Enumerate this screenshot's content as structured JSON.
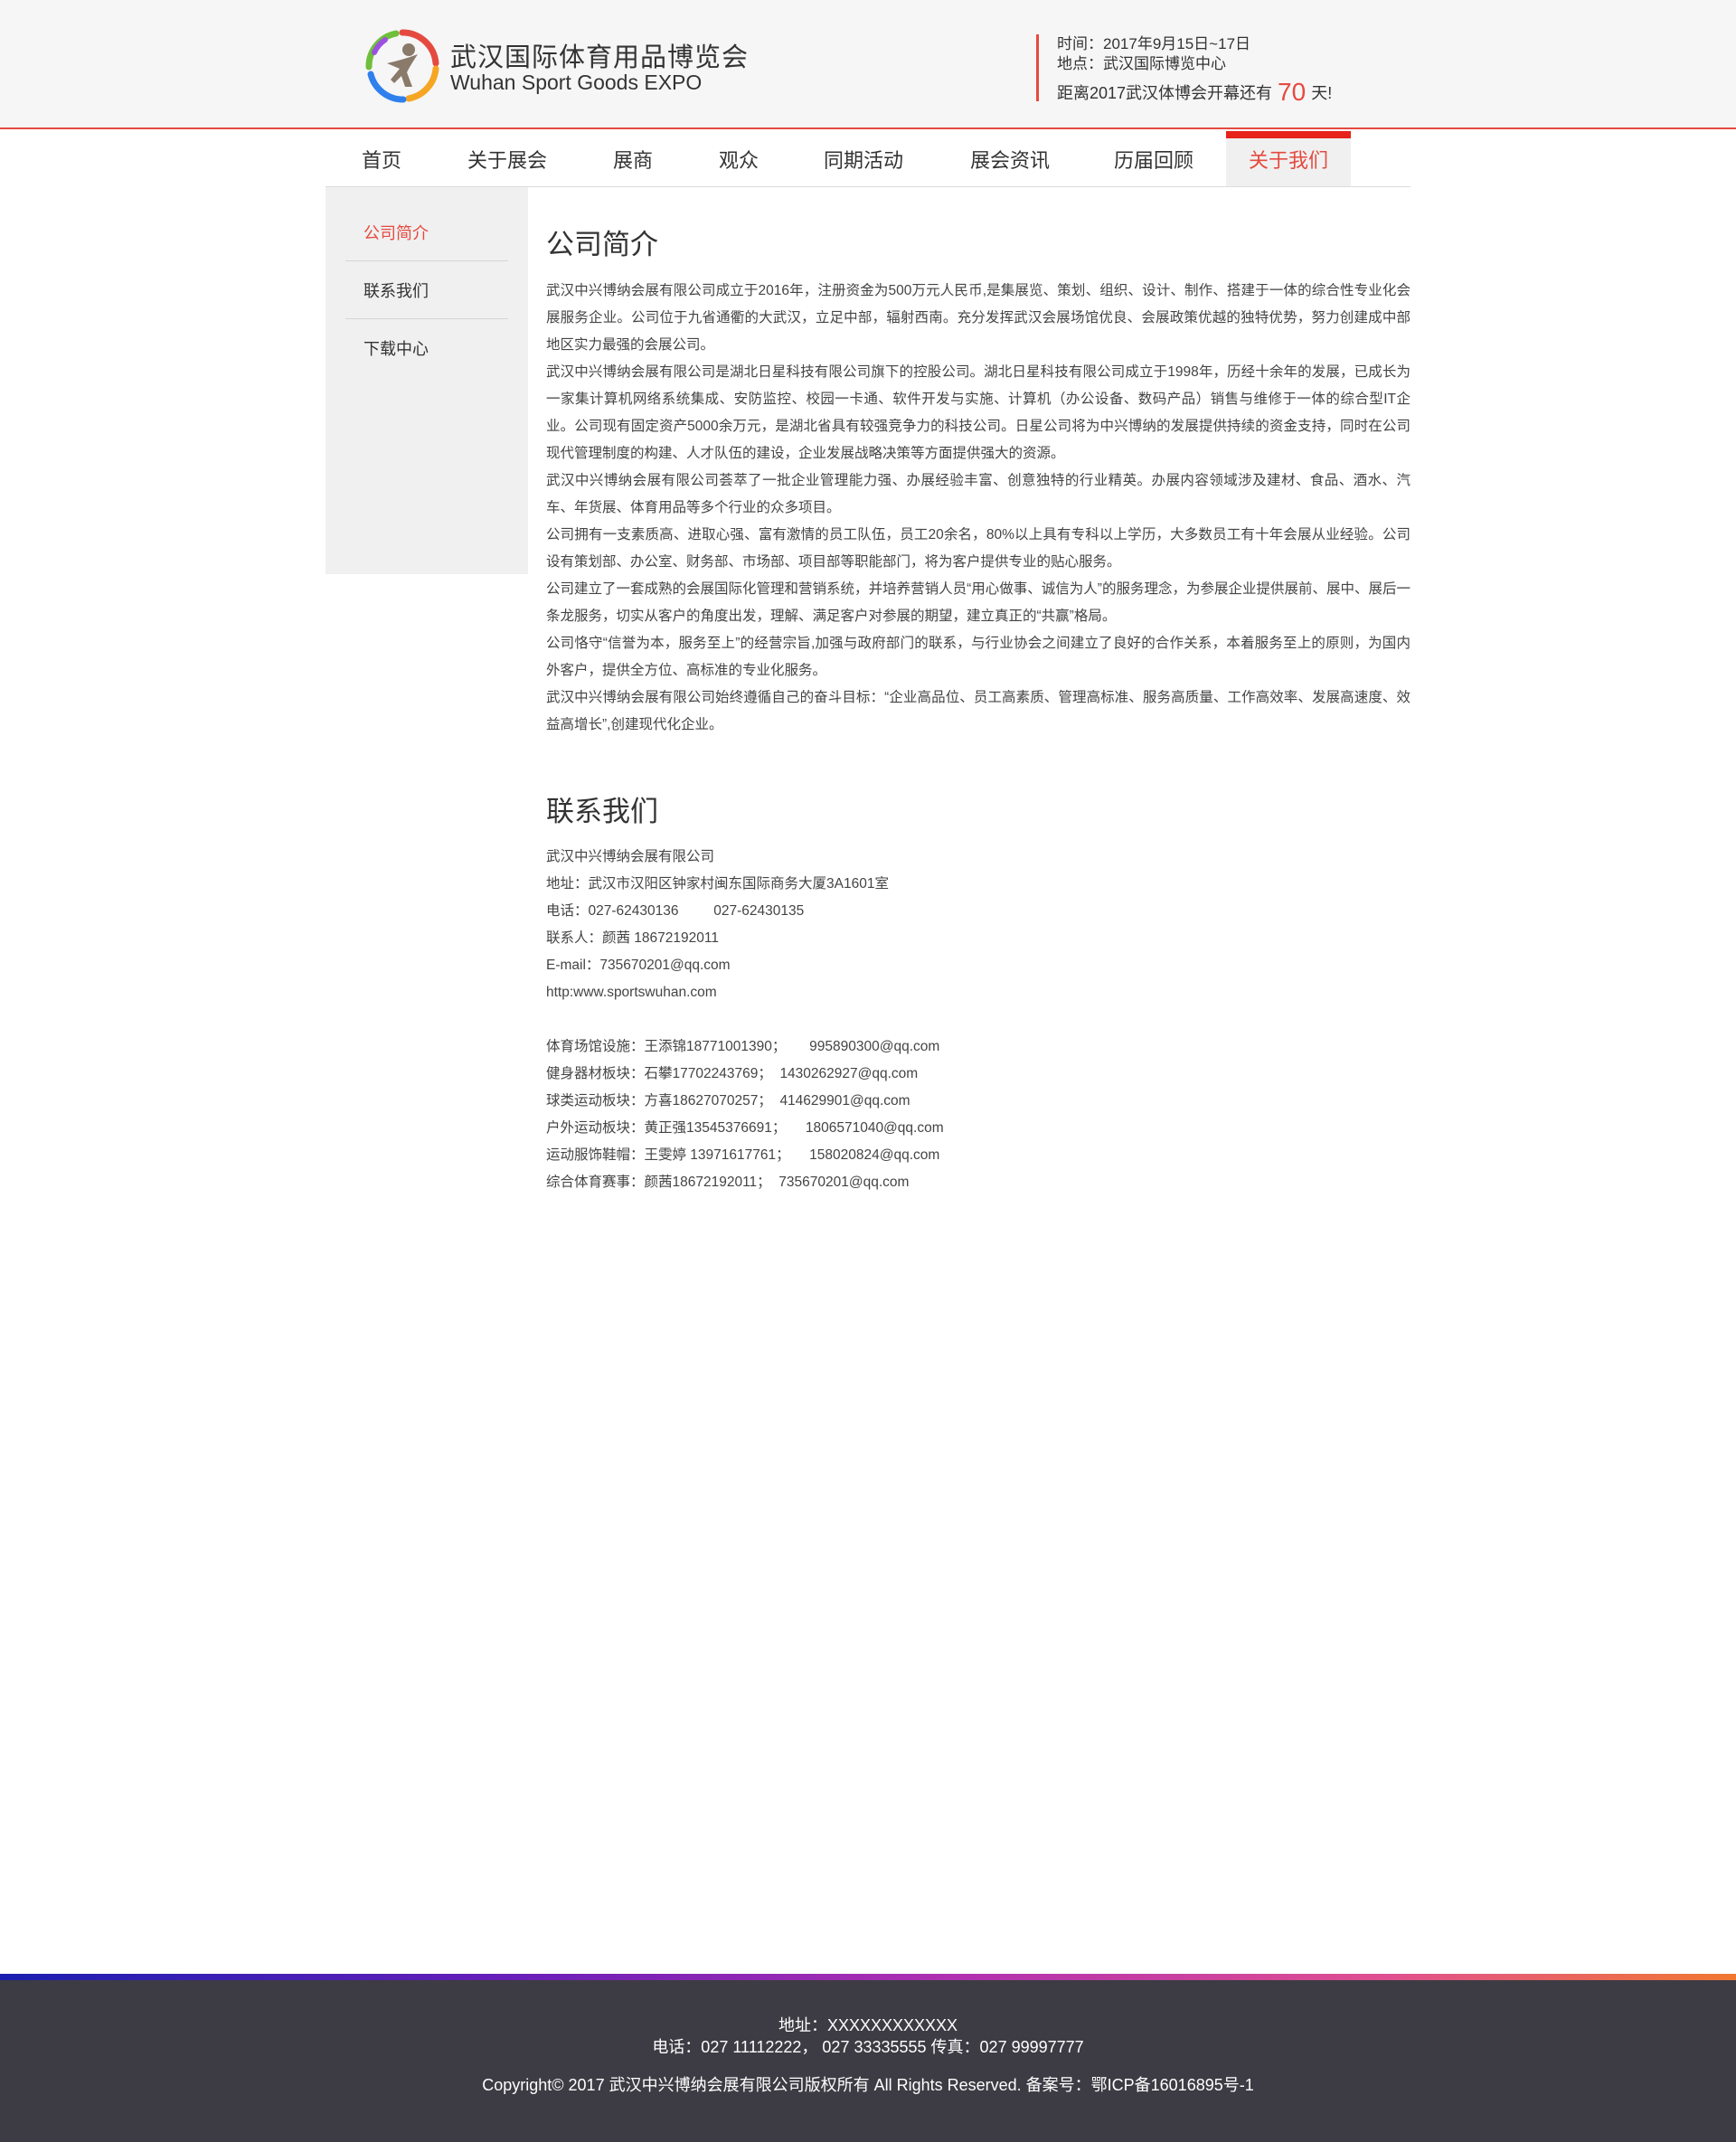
{
  "header": {
    "logo_cn": "武汉国际体育用品博览会",
    "logo_en": "Wuhan Sport Goods EXPO",
    "time_line": "时间：2017年9月15日~17日",
    "place_line": "地点：武汉国际博览中心",
    "countdown_prefix": "距离2017武汉体博会开幕还有",
    "countdown_days": "70",
    "countdown_suffix": "天!"
  },
  "nav": {
    "items": [
      {
        "label": "首页"
      },
      {
        "label": "关于展会"
      },
      {
        "label": "展商"
      },
      {
        "label": "观众"
      },
      {
        "label": "同期活动"
      },
      {
        "label": "展会资讯"
      },
      {
        "label": "历届回顾"
      },
      {
        "label": "关于我们"
      }
    ],
    "active_index": 7
  },
  "sidebar": {
    "items": [
      {
        "label": "公司简介"
      },
      {
        "label": "联系我们"
      },
      {
        "label": "下载中心"
      }
    ],
    "active_index": 0
  },
  "intro": {
    "title": "公司简介",
    "paragraphs": [
      "武汉中兴博纳会展有限公司成立于2016年，注册资金为500万元人民币,是集展览、策划、组织、设计、制作、搭建于一体的综合性专业化会展服务企业。公司位于九省通衢的大武汉，立足中部，辐射西南。充分发挥武汉会展场馆优良、会展政策优越的独特优势，努力创建成中部地区实力最强的会展公司。",
      "武汉中兴博纳会展有限公司是湖北日星科技有限公司旗下的控股公司。湖北日星科技有限公司成立于1998年，历经十余年的发展，已成长为一家集计算机网络系统集成、安防监控、校园一卡通、软件开发与实施、计算机（办公设备、数码产品）销售与维修于一体的综合型IT企业。公司现有固定资产5000余万元，是湖北省具有较强竞争力的科技公司。日星公司将为中兴博纳的发展提供持续的资金支持，同时在公司现代管理制度的构建、人才队伍的建设，企业发展战略决策等方面提供强大的资源。",
      "武汉中兴博纳会展有限公司荟萃了一批企业管理能力强、办展经验丰富、创意独特的行业精英。办展内容领域涉及建材、食品、酒水、汽车、年货展、体育用品等多个行业的众多项目。",
      "公司拥有一支素质高、进取心强、富有激情的员工队伍，员工20余名，80%以上具有专科以上学历，大多数员工有十年会展从业经验。公司设有策划部、办公室、财务部、市场部、项目部等职能部门，将为客户提供专业的贴心服务。",
      "公司建立了一套成熟的会展国际化管理和营销系统，并培养营销人员“用心做事、诚信为人”的服务理念，为参展企业提供展前、展中、展后一条龙服务，切实从客户的角度出发，理解、满足客户对参展的期望，建立真正的“共赢”格局。",
      "公司恪守“信誉为本，服务至上”的经营宗旨,加强与政府部门的联系，与行业协会之间建立了良好的合作关系，本着服务至上的原则，为国内外客户，提供全方位、高标准的专业化服务。",
      "武汉中兴博纳会展有限公司始终遵循自己的奋斗目标：“企业高品位、员工高素质、管理高标准、服务高质量、工作高效率、发展高速度、效益高增长”,创建现代化企业。"
    ]
  },
  "contact": {
    "title": "联系我们",
    "lines": [
      "武汉中兴博纳会展有限公司",
      "地址：武汉市汉阳区钟家村闽东国际商务大厦3A1601室",
      "电话：027-62430136         027-62430135",
      "联系人：颜茜 18672192011",
      "E-mail：735670201@qq.com",
      "http:www.sportswuhan.com"
    ],
    "segments": [
      "体育场馆设施：王添锦18771001390；      995890300@qq.com",
      "健身器材板块：石攀17702243769；  1430262927@qq.com",
      "球类运动板块：方喜18627070257；  414629901@qq.com",
      "户外运动板块：黄正强13545376691；     1806571040@qq.com",
      "运动服饰鞋帽：王雯婷 13971617761；     158020824@qq.com",
      "综合体育赛事：颜茜18672192011；  735670201@qq.com"
    ]
  },
  "footer": {
    "address": "地址：XXXXXXXXXXXX",
    "phone": "电话：027 11112222，  027 33335555 传真：027 99997777",
    "copyright": "Copyright© 2017 武汉中兴博纳会展有限公司版权所有 All Rights Reserved.  备案号：鄂ICP备16016895号-1"
  },
  "colors": {
    "accent": "#e54a40",
    "nav_active_bar": "#e7231a",
    "footer_bg": "#3d3c44",
    "sidebar_bg": "#f0f0f0"
  }
}
